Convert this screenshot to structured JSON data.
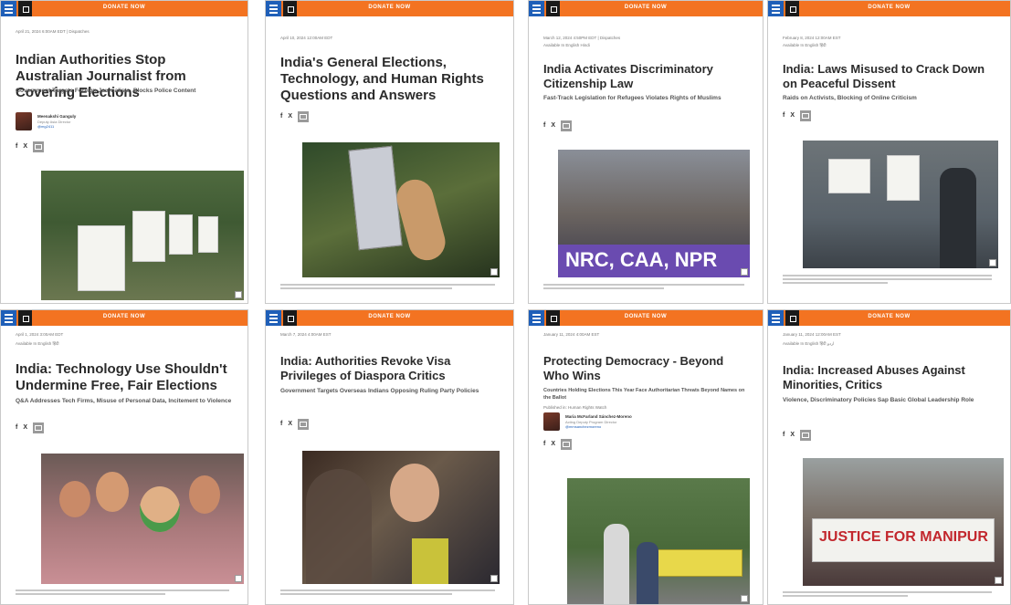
{
  "topbar": {
    "donate_label": "DONATE NOW"
  },
  "cards": [
    {
      "meta": "April 21, 2024 6:00AM EDT | Dispatches",
      "title": "Indian Authorities Stop Australian Journalist from Covering Elections",
      "subtitle": "Government Targets Foreign Journalists, Blocks Police Content",
      "author": {
        "name": "Meenakshi Ganguly",
        "role": "Deputy Asia Director",
        "link": "@mg2411"
      },
      "share": [
        "f",
        "X"
      ]
    },
    {
      "meta": "April 10, 2024 12:00AM EDT",
      "title": "India's General Elections, Technology, and Human Rights Questions and Answers",
      "share": [
        "f",
        "X"
      ]
    },
    {
      "meta": "March 12, 2024 4:50PM EDT | Dispatches",
      "meta2": "Available In  English  Hindi",
      "title": "India Activates Discriminatory Citizenship Law",
      "subtitle": "Fast-Track Legislation for Refugees Violates Rights of Muslims",
      "share": [
        "f",
        "X"
      ],
      "banner": "NRC, CAA, NPR"
    },
    {
      "meta": "February 8, 2024 12:00AM EST",
      "meta2": "Available In  English  हिंदी",
      "title": "India: Laws Misused to Crack Down on Peaceful Dissent",
      "subtitle": "Raids on Activists, Blocking of Online Criticism",
      "share": [
        "f",
        "X"
      ]
    },
    {
      "meta": "April 1, 2024 3:00AM EDT",
      "meta2": "Available In  English  हिंदी",
      "title": "India: Technology Use Shouldn't Undermine Free, Fair Elections",
      "subtitle": "Q&A Addresses Tech Firms, Misuse of Personal Data, Incitement to Violence",
      "share": [
        "f",
        "X"
      ]
    },
    {
      "meta": "March 7, 2024 4:00AM EST",
      "title": "India: Authorities Revoke Visa Privileges of Diaspora Critics",
      "subtitle": "Government Targets Overseas Indians Opposing Ruling Party Policies",
      "share": [
        "f",
        "X"
      ]
    },
    {
      "meta": "January 11, 2024 4:00AM EST",
      "title": "Protecting Democracy - Beyond Who Wins",
      "subtitle": "Countries Holding Elections This Year Face Authoritarian Threats Beyond Names on the Ballot",
      "meta2": "Published in: Human Rights Watch",
      "author": {
        "name": "Maria McFarland Sánchez-Moreno",
        "role": "Acting Deputy Program Director",
        "link": "@mmsanchezmoreno"
      },
      "share": [
        "f",
        "X"
      ]
    },
    {
      "meta": "January 11, 2024 12:00AM EST",
      "meta2": "Available In  English  हिंदी  اردو",
      "title": "India: Increased Abuses Against Minorities, Critics",
      "subtitle": "Violence, Discriminatory Policies Sap Basic Global Leadership Role",
      "share": [
        "f",
        "X"
      ],
      "banner": "JUSTICE FOR MANIPUR"
    }
  ],
  "icons": {
    "menu": "hamburger-menu-icon",
    "logo": "hrw-logo-icon",
    "mail": "email-share-icon",
    "expand": "expand-image-icon"
  },
  "colors": {
    "topbar": "#f37321",
    "menu": "#1f5fb8"
  }
}
